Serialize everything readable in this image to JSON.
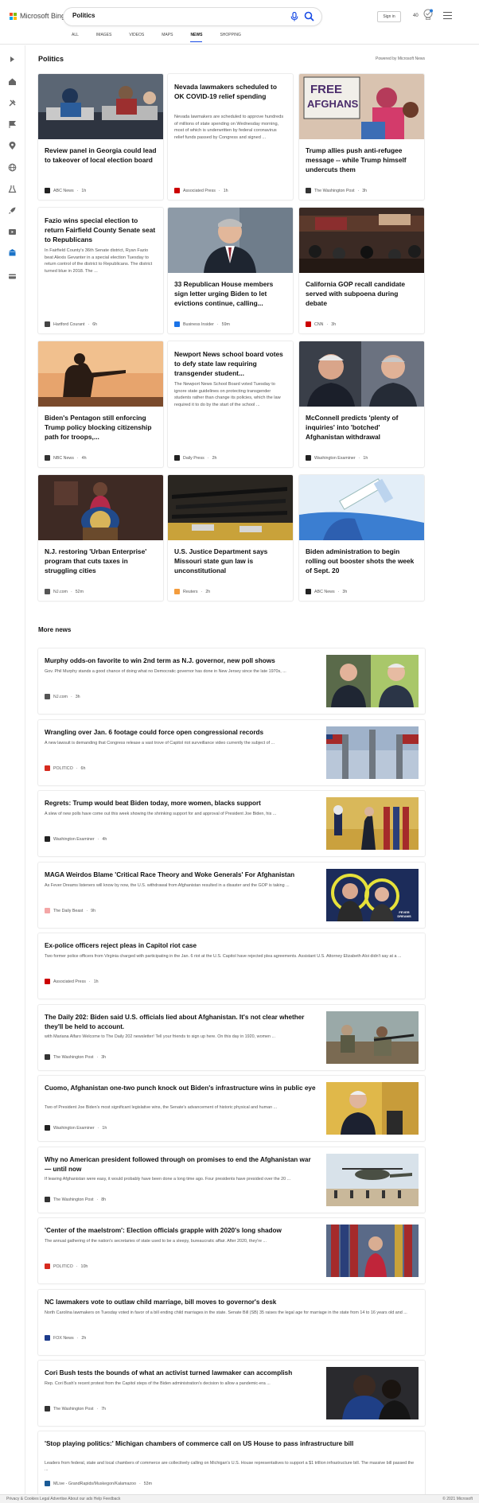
{
  "header": {
    "brand": "Microsoft Bing",
    "search_value": "Politics",
    "signin_label": "Sign in",
    "points": "40",
    "logo_colors": [
      "#f25022",
      "#7fba00",
      "#00a4ef",
      "#ffb900"
    ]
  },
  "scopes": [
    {
      "label": "ALL",
      "active": false
    },
    {
      "label": "IMAGES",
      "active": false
    },
    {
      "label": "VIDEOS",
      "active": false
    },
    {
      "label": "MAPS",
      "active": false
    },
    {
      "label": "NEWS",
      "active": true
    },
    {
      "label": "SHOPPING",
      "active": false
    }
  ],
  "sidebar": {
    "icons": [
      "expand-icon",
      "home-icon",
      "tools-icon",
      "flag-icon",
      "location-icon",
      "globe-icon",
      "science-icon",
      "rocket-icon",
      "video-icon",
      "bank-icon",
      "card-icon"
    ]
  },
  "main": {
    "section_title": "Politics",
    "powered_by": "Powered by Microsoft News",
    "more_title": "More news"
  },
  "cards": [
    {
      "title": "Review panel in Georgia could lead to takeover of local election board",
      "source": "ABC News",
      "time": "1h",
      "image": "election-workers-photo",
      "src_color": "#222222"
    },
    {
      "title": "Nevada lawmakers scheduled to OK COVID-19 relief spending",
      "snippet": "Nevada lawmakers are scheduled to approve hundreds of millions of state spending on Wednesday morning, most of which is underwritten by federal coronavirus relief funds passed by Congress and signed ...",
      "source": "Associated Press",
      "time": "1h",
      "image": "",
      "src_color": "#cc0000"
    },
    {
      "title": "Trump allies push anti-refugee message -- while Trump himself undercuts them",
      "source": "The Washington Post",
      "time": "3h",
      "image": "free-afghans-protest-photo",
      "src_color": "#333333"
    },
    {
      "title": "Fazio wins special election to return Fairfield County Senate seat to Republicans",
      "snippet": "In Fairfield County's 36th Senate district, Ryan Fazio beat Alexis Gevanter in a special election Tuesday to return control of the district to Republicans. The district turned blue in 2018. The ...",
      "source": "Hartford Courant",
      "time": "6h",
      "image": "",
      "src_color": "#444444"
    },
    {
      "title": "33 Republican House members sign letter urging Biden to let evictions continue, calling...",
      "source": "Business Insider",
      "time": "59m",
      "image": "congressman-portrait-photo",
      "src_color": "#1a73e8"
    },
    {
      "title": "California GOP recall candidate served with subpoena during debate",
      "source": "CNN",
      "time": "3h",
      "image": "debate-audience-photo",
      "src_color": "#cc0000"
    },
    {
      "title": "Biden's Pentagon still enforcing Trump policy blocking citizenship path for troops,...",
      "source": "NBC News",
      "time": "4h",
      "image": "soldier-silhouette-photo",
      "src_color": "#333333"
    },
    {
      "title": "Newport News school board votes to defy state law requiring transgender student...",
      "snippet": "The Newport News School Board voted Tuesday to ignore state guidelines on protecting transgender students rather than change its policies, which the law required it to do by the start of the school ...",
      "source": "Daily Press",
      "time": "2h",
      "image": "",
      "src_color": "#222222"
    },
    {
      "title": "McConnell predicts 'plenty of inquiries' into 'botched' Afghanistan withdrawal",
      "source": "Washington Examiner",
      "time": "1h",
      "image": "biden-mcconnell-photo",
      "src_color": "#222222"
    },
    {
      "title": "N.J. restoring 'Urban Enterprise' program that cuts taxes in struggling cities",
      "source": "NJ.com",
      "time": "52m",
      "image": "podium-speaker-photo",
      "src_color": "#555555"
    },
    {
      "title": "U.S. Justice Department says Missouri state gun law is unconstitutional",
      "source": "Reuters",
      "time": "2h",
      "image": "guns-display-photo",
      "src_color": "#f39c3d"
    },
    {
      "title": "Biden administration to begin rolling out booster shots the week of Sept. 20",
      "source": "ABC News",
      "time": "3h",
      "image": "vaccine-syringe-photo",
      "src_color": "#222222"
    }
  ],
  "more_news": [
    {
      "title": "Murphy odds-on favorite to win 2nd term as N.J. governor, new poll shows",
      "snippet": "Gov. Phil Murphy stands a good chance of doing what no Democratic governor has done in New Jersey since the late 1970s, ...",
      "source": "NJ.com",
      "time": "3h",
      "image": "two-candidates-photo",
      "src_color": "#555555"
    },
    {
      "title": "Wrangling over Jan. 6 footage could force open congressional records",
      "snippet": "A new lawsuit is demanding that Congress release a vast trove of Capitol riot surveillance video currently the subject of ...",
      "source": "POLITICO",
      "time": "6h",
      "image": "capitol-flags-photo",
      "src_color": "#d62b1f"
    },
    {
      "title": "Regrets: Trump would beat Biden today, more women, blacks support",
      "snippet": "A slew of new polls have come out this week showing the shrinking support for and approval of President Joe Biden, his ...",
      "source": "Washington Examiner",
      "time": "4h",
      "image": "president-walking-photo",
      "src_color": "#222222"
    },
    {
      "title": "MAGA Weirdos Blame 'Critical Race Theory and Woke Generals' For Afghanistan",
      "snippet": "As Fever Dreams listeners will know by now, the U.S. withdrawal from Afghanistan resulted in a disaster and the GOP is taking ...",
      "source": "The Daily Beast",
      "time": "9h",
      "image": "fever-dreams-graphic",
      "badge": "FEVER DREAMS",
      "src_color": "#f4a6a6"
    },
    {
      "title": "Ex-police officers reject pleas in Capitol riot case",
      "snippet": "Two former police officers from Virginia charged with participating in the Jan. 6 riot at the U.S. Capitol have rejected plea agreements. Assistant U.S. Attorney Elizabeth Aloi didn't say at a ...",
      "source": "Associated Press",
      "time": "1h",
      "image": "",
      "src_color": "#cc0000"
    },
    {
      "title": "The Daily 202: Biden said U.S. officials lied about Afghanistan. It's not clear whether they'll be held to account.",
      "snippet": "with Mariana Alfaro Welcome to The Daily 202 newsletter! Tell your friends to sign up here. On this day in 1920, women ...",
      "source": "The Washington Post",
      "time": "3h",
      "image": "soldiers-field-photo",
      "src_color": "#333333"
    },
    {
      "title": "Cuomo, Afghanistan one-two punch knock out Biden's infrastructure wins in public eye",
      "snippet": "Two of President Joe Biden's most significant legislative wins, the Senate's advancement of historic physical and human ...",
      "source": "Washington Examiner",
      "time": "1h",
      "image": "biden-speaking-photo",
      "src_color": "#222222"
    },
    {
      "title": "Why no American president followed through on promises to end the Afghanistan war — until now",
      "snippet": "If leaving Afghanistan were easy, it would probably have been done a long time ago. Four presidents have presided over the 20 ...",
      "source": "The Washington Post",
      "time": "8h",
      "image": "helicopter-troops-photo",
      "src_color": "#333333"
    },
    {
      "title": "'Center of the maelstrom': Election officials grapple with 2020's long shadow",
      "snippet": "The annual gathering of the nation's secretaries of state used to be a sleepy, bureaucratic affair. After 2020, they're ...",
      "source": "POLITICO",
      "time": "10h",
      "image": "officials-flags-photo",
      "src_color": "#d62b1f"
    },
    {
      "title": "NC lawmakers vote to outlaw child marriage, bill moves to governor's desk",
      "snippet": "North Carolina lawmakers on Tuesday voted in favor of a bill ending child marriages in the state. Senate Bill (SB) 35 raises the legal age for marriage in the state from 14 to 16 years old and ...",
      "source": "FOX News",
      "time": "2h",
      "image": "",
      "src_color": "#1d3b8b"
    },
    {
      "title": "Cori Bush tests the bounds of what an activist turned lawmaker can accomplish",
      "snippet": "Rep. Cori Bush's recent protest from the Capitol steps of the Biden administration's decision to allow a pandemic-era ...",
      "source": "The Washington Post",
      "time": "7h",
      "image": "hug-photo",
      "src_color": "#333333"
    },
    {
      "title": "'Stop playing politics:' Michigan chambers of commerce call on US House to pass infrastructure bill",
      "snippet": "Leaders from federal, state and local chambers of commerce are collectively calling on Michigan's U.S. House representatives to support a $1 trillion infrastructure bill. The massive bill passed the ...",
      "source": "MLive - GrandRapids/Muskegon/Kalamazoo",
      "time": "53m",
      "image": "",
      "src_color": "#1a5a96"
    }
  ],
  "footer": {
    "left": "Privacy & Cookies   Legal   Advertise   About our ads   Help   Feedback",
    "right": "© 2021 Microsoft"
  }
}
